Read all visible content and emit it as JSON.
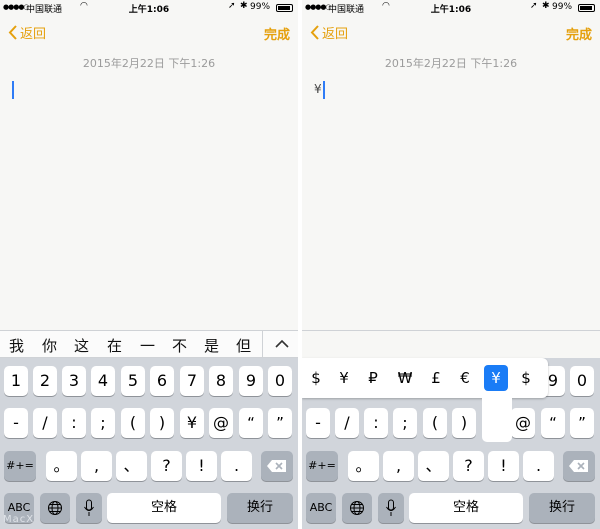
{
  "status": {
    "signal": "●●●●○",
    "carrier": "中国联通",
    "time": "上午1:06",
    "battery": "99%"
  },
  "nav": {
    "back_label": "返回",
    "done_label": "完成"
  },
  "note": {
    "date": "2015年2月22日 下午1:26",
    "left_text": "",
    "right_text": "¥"
  },
  "candidates": [
    "我",
    "你",
    "这",
    "在",
    "一",
    "不",
    "是",
    "但"
  ],
  "keys": {
    "row1": [
      "1",
      "2",
      "3",
      "4",
      "5",
      "6",
      "7",
      "8",
      "9",
      "0"
    ],
    "row2": [
      "-",
      "/",
      ":",
      ";",
      "(",
      ")",
      "¥",
      "@",
      "“",
      "”"
    ],
    "row3_mode": "#+=",
    "row3": [
      "。",
      ",",
      "、",
      "?",
      "!",
      "."
    ],
    "row4": {
      "abc": "ABC",
      "space": "空格",
      "return": "换行"
    }
  },
  "currency_popup": [
    "$",
    "¥",
    "₽",
    "₩",
    "£",
    "€",
    "¥",
    "$"
  ],
  "currency_selected_index": 6,
  "watermark": "MacX",
  "colors": {
    "accent": "#e5a00d",
    "selected_key": "#1a7cf6",
    "keyboard_bg": "#d1d5db"
  }
}
